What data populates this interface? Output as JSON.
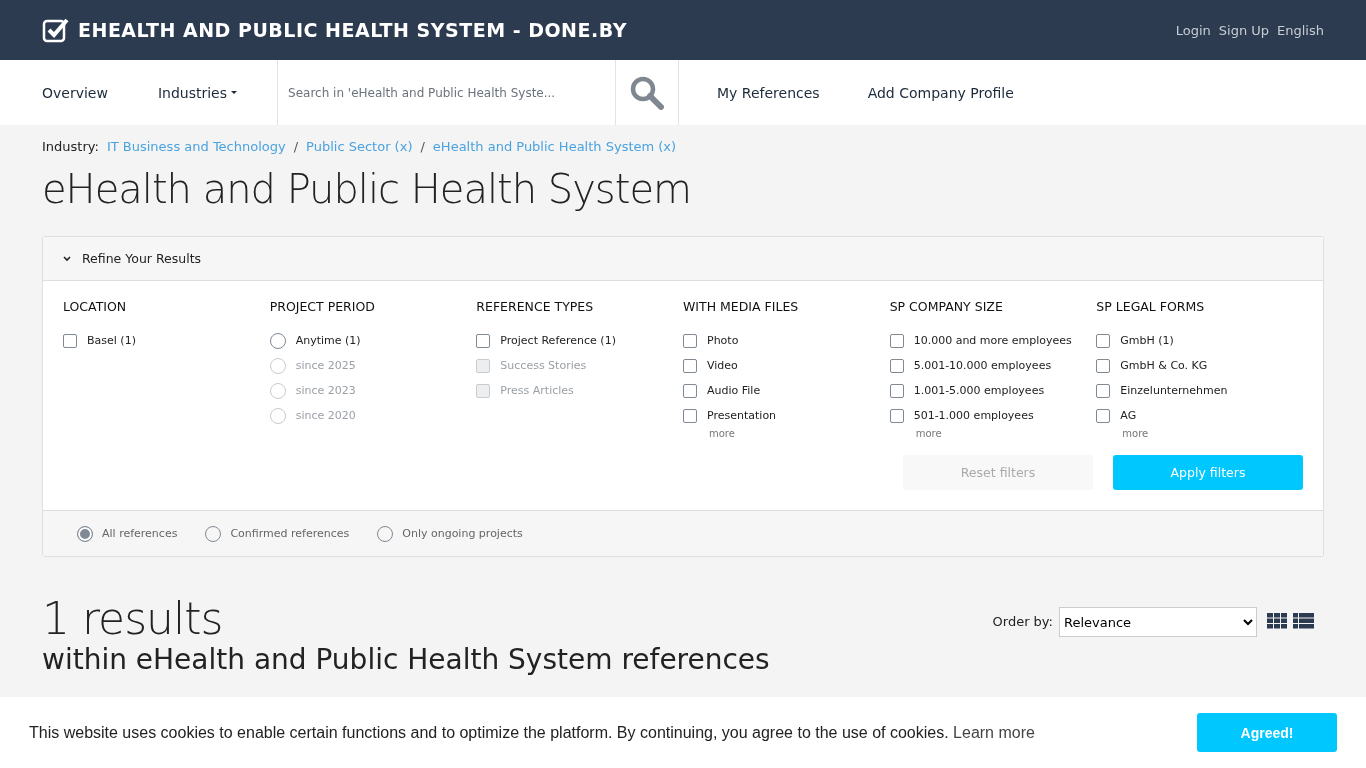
{
  "header": {
    "title": "EHEALTH AND PUBLIC HEALTH SYSTEM - DONE.BY",
    "links": [
      "Login",
      "Sign Up",
      "English"
    ]
  },
  "nav": {
    "items": [
      {
        "label": "Overview",
        "dropdown": false
      },
      {
        "label": "Industries",
        "dropdown": true
      }
    ],
    "search": {
      "placeholder": "Search in 'eHealth and Public Health Syste..."
    },
    "links": [
      "My References",
      "Add Company Profile"
    ]
  },
  "breadcrumb": {
    "label": "Industry:",
    "separator": "/",
    "items": [
      "IT Business and Technology",
      "Public Sector (x)",
      "eHealth and Public Health System (x)"
    ]
  },
  "page_title": "eHealth and Public Health System",
  "filters": {
    "title": "Refine Your Results",
    "expanded": true,
    "groups": [
      {
        "title": "LOCATION",
        "options": [
          {
            "kind": "checkbox",
            "label": "Basel (1)",
            "checked": false,
            "disabled": false
          }
        ]
      },
      {
        "title": "PROJECT PERIOD",
        "options": [
          {
            "kind": "radio",
            "label": "Anytime (1)",
            "checked": false,
            "disabled": false
          },
          {
            "kind": "radio",
            "label": "since 2025",
            "checked": false,
            "disabled": true
          },
          {
            "kind": "radio",
            "label": "since 2023",
            "checked": false,
            "disabled": true
          },
          {
            "kind": "radio",
            "label": "since 2020",
            "checked": false,
            "disabled": true
          }
        ]
      },
      {
        "title": "REFERENCE TYPES",
        "options": [
          {
            "kind": "checkbox",
            "label": "Project Reference (1)",
            "checked": false,
            "disabled": false
          },
          {
            "kind": "checkbox",
            "label": "Success Stories",
            "checked": false,
            "disabled": true
          },
          {
            "kind": "checkbox",
            "label": "Press Articles",
            "checked": false,
            "disabled": true
          }
        ]
      },
      {
        "title": "WITH MEDIA FILES",
        "more": "more",
        "options": [
          {
            "kind": "checkbox",
            "label": "Photo",
            "checked": false,
            "disabled": false
          },
          {
            "kind": "checkbox",
            "label": "Video",
            "checked": false,
            "disabled": false
          },
          {
            "kind": "checkbox",
            "label": "Audio File",
            "checked": false,
            "disabled": false
          },
          {
            "kind": "checkbox",
            "label": "Presentation",
            "checked": false,
            "disabled": false
          }
        ]
      },
      {
        "title": "SP COMPANY SIZE",
        "more": "more",
        "options": [
          {
            "kind": "checkbox",
            "label": "10.000 and more employees",
            "checked": false,
            "disabled": false
          },
          {
            "kind": "checkbox",
            "label": "5.001-10.000 employees",
            "checked": false,
            "disabled": false
          },
          {
            "kind": "checkbox",
            "label": "1.001-5.000 employees",
            "checked": false,
            "disabled": false
          },
          {
            "kind": "checkbox",
            "label": "501-1.000 employees",
            "checked": false,
            "disabled": false
          }
        ]
      },
      {
        "title": "SP LEGAL FORMS",
        "more": "more",
        "options": [
          {
            "kind": "checkbox",
            "label": "GmbH (1)",
            "checked": false,
            "disabled": false
          },
          {
            "kind": "checkbox",
            "label": "GmbH & Co. KG",
            "checked": false,
            "disabled": false
          },
          {
            "kind": "checkbox",
            "label": "Einzelunternehmen",
            "checked": false,
            "disabled": false
          },
          {
            "kind": "checkbox",
            "label": "AG",
            "checked": false,
            "disabled": false
          }
        ]
      }
    ],
    "reset": {
      "label": "Reset filters",
      "disabled": true
    },
    "apply": {
      "label": "Apply filters"
    },
    "scope": [
      {
        "label": "All references",
        "selected": true
      },
      {
        "label": "Confirmed references",
        "selected": false
      },
      {
        "label": "Only ongoing projects",
        "selected": false
      }
    ]
  },
  "results": {
    "count": "1 results",
    "subtitle": "within eHealth and Public Health System references",
    "order_label": "Order by:",
    "order_value": "Relevance",
    "view": [
      {
        "kind": "grid"
      },
      {
        "kind": "list"
      }
    ]
  },
  "cookie": {
    "text": "This website uses cookies to enable certain functions and to optimize the platform. By continuing, you agree to the use of cookies.",
    "link": "Learn more",
    "button": "Agreed!"
  }
}
